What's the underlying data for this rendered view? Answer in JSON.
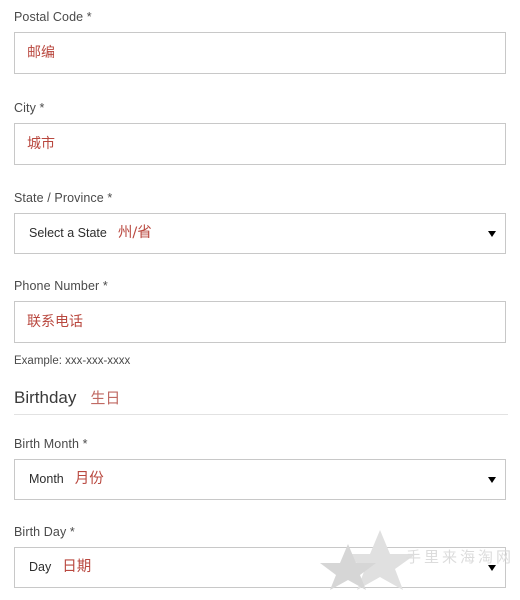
{
  "form": {
    "fields": [
      {
        "key": "postal_code",
        "label": "Postal Code",
        "required_mark": "*",
        "type": "text",
        "value_cn": "邮编"
      },
      {
        "key": "city",
        "label": "City",
        "required_mark": "*",
        "type": "text",
        "value_cn": "城市"
      },
      {
        "key": "state_province",
        "label": "State / Province",
        "required_mark": "*",
        "type": "select",
        "selected": "Select a State",
        "value_cn": "州/省",
        "caret": "chevron-down-icon"
      },
      {
        "key": "phone_number",
        "label": "Phone Number",
        "required_mark": "*",
        "type": "text",
        "value_cn": "联系电话",
        "hint": "Example: xxx-xxx-xxxx"
      },
      {
        "key": "birth_month",
        "label": "Birth Month",
        "required_mark": "*",
        "type": "select",
        "selected": "Month",
        "value_cn": "月份",
        "caret": "chevron-down-icon"
      },
      {
        "key": "birth_day",
        "label": "Birth Day",
        "required_mark": "*",
        "type": "select",
        "selected": "Day",
        "value_cn": "日期",
        "caret": "chevron-down-icon"
      }
    ],
    "section": {
      "title": "Birthday",
      "title_cn": "生日"
    }
  },
  "watermark": {
    "text": "手里来海淘网",
    "icon": "star-icon"
  },
  "colors": {
    "annotation_red": "#b9483f",
    "label_gray": "#4a4a4a",
    "border_gray": "#c8c8c8",
    "rule_gray": "#e2e2e2",
    "watermark_gray": "#dcdcdc"
  }
}
